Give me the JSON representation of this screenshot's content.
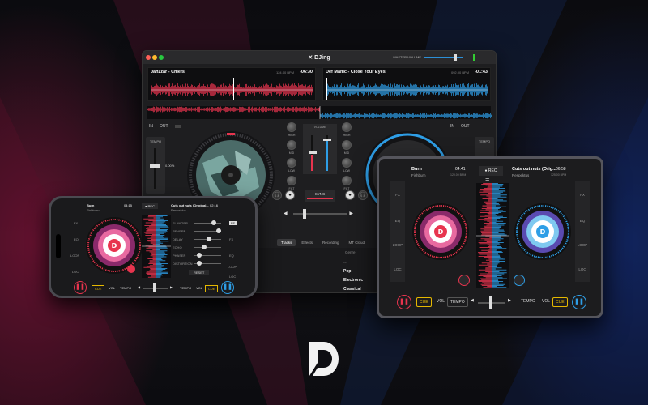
{
  "colors": {
    "deck_a": "#e8344e",
    "deck_b": "#2e9ee6",
    "accent_yellow": "#e5b800",
    "vu_green": "#33cc33"
  },
  "mac": {
    "title": "✕ DJing",
    "master_volume_label": "MASTER VOLUME",
    "deck_a": {
      "track": "Jahzzar - Chiefs",
      "date": "124.00 BPM",
      "time": "-06:30"
    },
    "deck_b": {
      "track": "Def Manic - Close Your Eyes",
      "date": "092.00 BPM",
      "time": "-01:43"
    },
    "in_label": "IN",
    "out_label": "OUT",
    "tempo_label": "TEMPO",
    "tempo_value": "0.00%",
    "mixer": {
      "left_knobs": [
        "HIGH",
        "MID",
        "LOW",
        "FILT"
      ],
      "right_knobs": [
        "HIGH",
        "MID",
        "LOW",
        "FILT"
      ],
      "volume_label": "VOLUME",
      "sync_label": "SYNC"
    },
    "tabs": [
      "Tracks",
      "Effects",
      "Recording",
      "MT Cloud"
    ],
    "active_tab": "Tracks",
    "genre_header": "Genre",
    "genres": [
      "---",
      "Pop",
      "Electronic",
      "Classical"
    ]
  },
  "iphone": {
    "deck_a": {
      "track": "Burn",
      "artist": "Fishburn",
      "time": "04:15"
    },
    "deck_b": {
      "track": "Cuts out nuts (Original...",
      "artist": "Respektus",
      "time": "02:16"
    },
    "rec_label": "REC",
    "left_side": [
      "FX",
      "EQ",
      "LOOP",
      "LOC"
    ],
    "right_side": [
      "FE",
      "FX",
      "EQ",
      "LOOP",
      "LOC"
    ],
    "eq_labels": [
      "FLANGER",
      "REVERB",
      "DELAY",
      "ECHO",
      "PHASER",
      "DISTORTION"
    ],
    "reset_label": "RESET",
    "bottom": [
      "CUE",
      "VOL",
      "TEMPO",
      "TEMPO",
      "VOL",
      "CUE"
    ]
  },
  "ipad": {
    "deck_a": {
      "track": "Burn",
      "artist": "Fishburn",
      "time": "04:41",
      "bpm": "120.00 BPM"
    },
    "deck_b": {
      "track": "Cuts out nuts (Orig...",
      "artist": "Respektus",
      "time": "06:58",
      "bpm": "125.00 BPM"
    },
    "rec_label": "REC",
    "left_side": [
      "FX",
      "EQ",
      "LOOP",
      "LOC"
    ],
    "right_side": [
      "FX",
      "EQ",
      "LOOP",
      "LOC"
    ],
    "bottom": [
      "CUE",
      "VOL",
      "TEMPO",
      "TEMPO",
      "VOL",
      "CUE"
    ]
  }
}
